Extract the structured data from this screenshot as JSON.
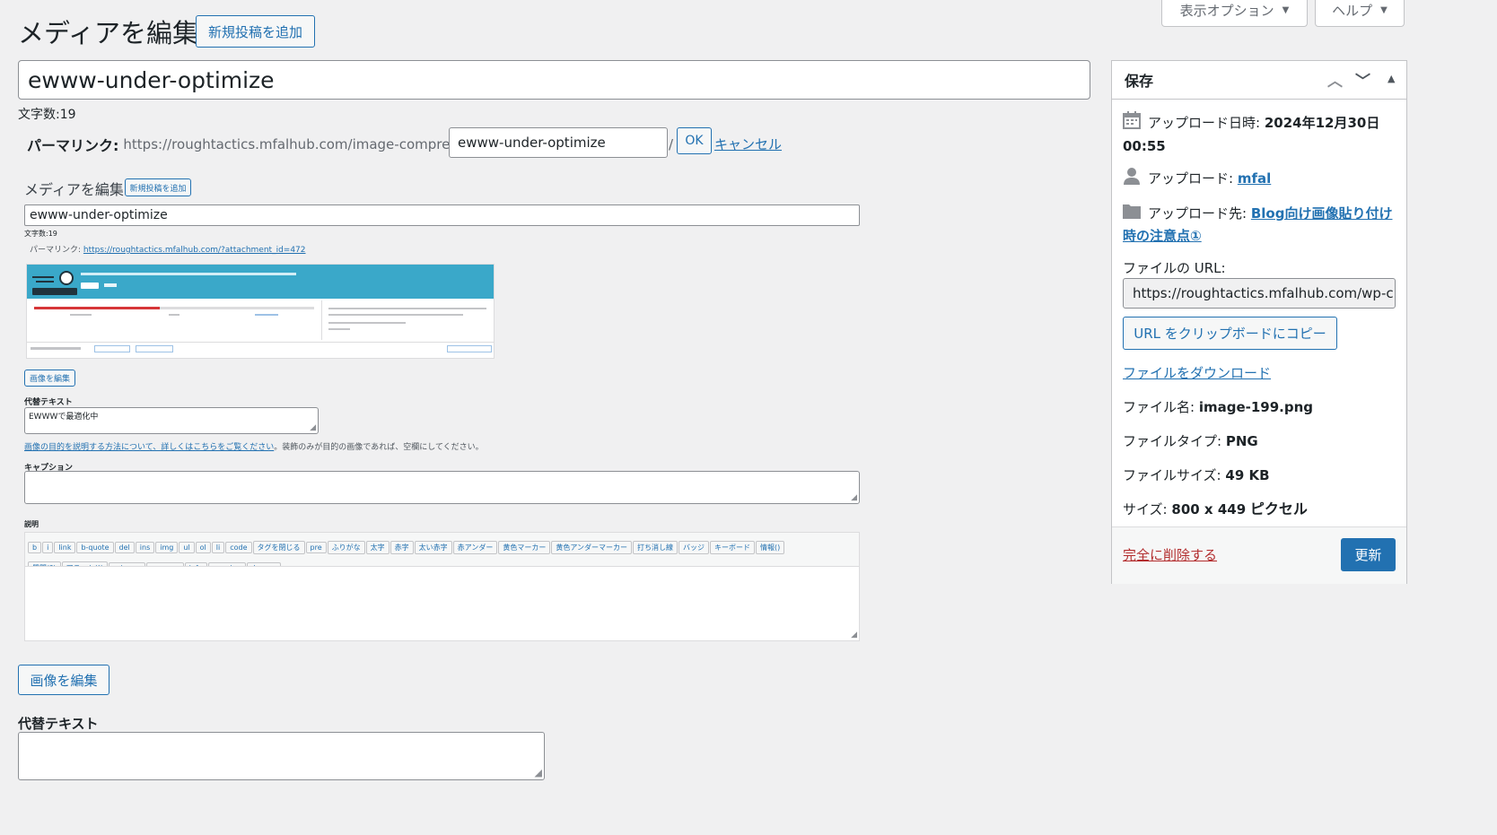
{
  "page": {
    "title": "メディアを編集",
    "add_new": "新規投稿を追加",
    "screen_options": "表示オプション",
    "help": "ヘルプ"
  },
  "post": {
    "title_value": "ewww-under-optimize",
    "char_count": "文字数:19",
    "permalink_label": "パーマリンク:",
    "permalink_base": "https://roughtactics.mfalhub.com/image-compression/",
    "slug_value": "ewww-under-optimize",
    "slash": "/",
    "ok": "OK",
    "cancel": "キャンセル"
  },
  "embedded": {
    "title": "メディアを編集",
    "add_new": "新規投稿を追加",
    "title_value": "ewww-under-optimize",
    "char_count": "文字数:19",
    "permalink_label": "パーマリンク:",
    "permalink_url": "https://roughtactics.mfalhub.com/?attachment_id=472",
    "edit_image": "画像を編集",
    "alt_label": "代替テキスト",
    "alt_value": "EWWWで最適化中",
    "alt_help_link": "画像の目的を説明する方法について、詳しくはこちらをご覧ください",
    "alt_help_text": "。装飾のみが目的の画像であれば、空欄にしてください。",
    "caption_label": "キャプション",
    "desc_label": "説明",
    "quicktags_row1": [
      "b",
      "i",
      "link",
      "b-quote",
      "del",
      "ins",
      "img",
      "ul",
      "ol",
      "li",
      "code",
      "タグを閉じる",
      "pre",
      "ふりがな",
      "太字",
      "赤字",
      "太い赤字",
      "赤アンダー",
      "黄色マーカー",
      "黄色アンダーマーカー",
      "打ち消し線",
      "バッジ",
      "キーボード",
      "情報()"
    ],
    "quicktags_row2": [
      "質問(?)",
      "アラート(!)",
      "primary",
      "success",
      "info",
      "warning",
      "danger"
    ]
  },
  "main": {
    "edit_image": "画像を編集",
    "alt_label": "代替テキスト"
  },
  "sidebar": {
    "title": "保存",
    "upload_date_label": "アップロード日時:",
    "upload_date_value": "2024年12月30日",
    "upload_time": "00:55",
    "uploader_label": "アップロード:",
    "uploader_value": "mfal",
    "uploaded_to_label": "アップロード先:",
    "uploaded_to_value_1": "Blog向け画像貼り付け",
    "uploaded_to_value_2": "時の注意点①",
    "file_url_label": "ファイルの URL:",
    "file_url_value": "https://roughtactics.mfalhub.com/wp-c",
    "copy_url": "URL をクリップボードにコピー",
    "download": "ファイルをダウンロード",
    "file_name_label": "ファイル名:",
    "file_name_value": "image-199.png",
    "file_type_label": "ファイルタイプ:",
    "file_type_value": "PNG",
    "file_size_label": "ファイルサイズ:",
    "file_size_value": "49 KB",
    "dimensions_label": "サイズ:",
    "dimensions_value": "800 x 449",
    "dimensions_unit": "ピクセル",
    "delete": "完全に削除する",
    "update": "更新"
  },
  "icons": [
    "calendar-icon",
    "user-icon",
    "folder-icon",
    "chevron-up-icon",
    "chevron-down-icon",
    "collapse-triangle-icon"
  ],
  "colors": {
    "accent": "#2271b1",
    "delete": "#b32d2e",
    "background": "#f0f0f1"
  }
}
